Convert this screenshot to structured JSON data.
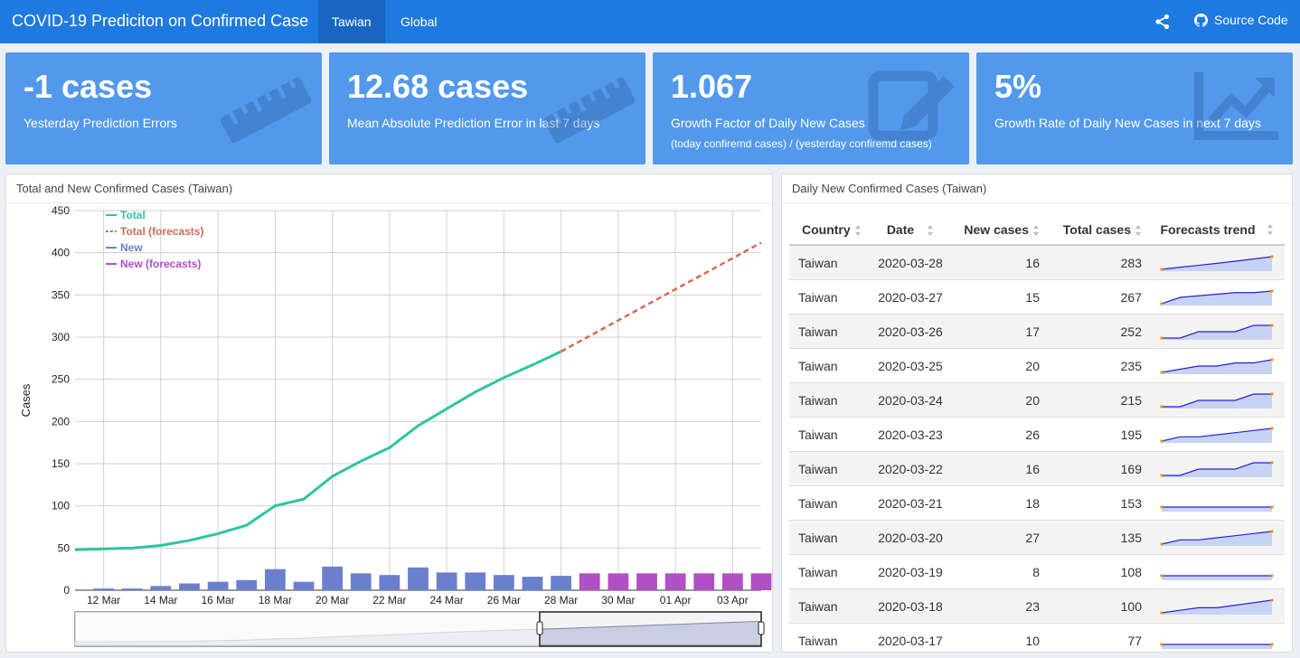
{
  "navbar": {
    "title": "COVID-19 Prediciton on Confirmed Case",
    "tabs": [
      {
        "label": "Tawian",
        "active": true
      },
      {
        "label": "Global",
        "active": false
      }
    ],
    "share_icon": "share-icon",
    "source_label": "Source Code",
    "source_icon": "github-icon",
    "bg_color": "#1f7ae0"
  },
  "value_boxes": [
    {
      "value": "-1 cases",
      "subtitle": "Yesterday Prediction Errors",
      "note": "",
      "icon": "ruler-icon"
    },
    {
      "value": "12.68 cases",
      "subtitle": "Mean Absolute Prediction Error in last 7 days",
      "note": "",
      "icon": "ruler-icon"
    },
    {
      "value": "1.067",
      "subtitle": "Growth Factor of Daily New Cases",
      "note": "(today confiremd cases) / (yesterday confiremd cases)",
      "icon": "edit-icon"
    },
    {
      "value": "5%",
      "subtitle": "Growth Rate of Daily New Cases in next 7 days",
      "note": "",
      "icon": "chart-line-icon"
    }
  ],
  "chart_panel": {
    "title": "Total and New Confirmed Cases (Taiwan)"
  },
  "table_panel": {
    "title": "Daily New Confirmed Cases (Taiwan)"
  },
  "chart_data": {
    "type": "line",
    "ylabel": "Cases",
    "ylim": [
      0,
      450
    ],
    "yticks": [
      0,
      50,
      100,
      150,
      200,
      250,
      300,
      350,
      400,
      450
    ],
    "xtick_labels": [
      "12 Mar",
      "14 Mar",
      "16 Mar",
      "18 Mar",
      "20 Mar",
      "22 Mar",
      "24 Mar",
      "26 Mar",
      "28 Mar",
      "30 Mar",
      "01 Apr",
      "03 Apr"
    ],
    "legend_position": "top-left",
    "grid": true,
    "series": [
      {
        "name": "Total",
        "kind": "line",
        "color": "#2ec4a1",
        "x": [
          "2020-03-11",
          "2020-03-12",
          "2020-03-13",
          "2020-03-14",
          "2020-03-15",
          "2020-03-16",
          "2020-03-17",
          "2020-03-18",
          "2020-03-19",
          "2020-03-20",
          "2020-03-21",
          "2020-03-22",
          "2020-03-23",
          "2020-03-24",
          "2020-03-25",
          "2020-03-26",
          "2020-03-27",
          "2020-03-28"
        ],
        "values": [
          48,
          49,
          50,
          53,
          59,
          67,
          77,
          100,
          108,
          135,
          153,
          169,
          195,
          215,
          235,
          252,
          267,
          283
        ]
      },
      {
        "name": "Total (forecasts)",
        "kind": "dashed-line",
        "color": "#d26b55",
        "x": [
          "2020-03-28",
          "2020-04-04"
        ],
        "values": [
          283,
          412
        ]
      },
      {
        "name": "New",
        "kind": "bar",
        "color": "#6b80cc",
        "x": [
          "2020-03-12",
          "2020-03-13",
          "2020-03-14",
          "2020-03-15",
          "2020-03-16",
          "2020-03-17",
          "2020-03-18",
          "2020-03-19",
          "2020-03-20",
          "2020-03-21",
          "2020-03-22",
          "2020-03-23",
          "2020-03-24",
          "2020-03-25",
          "2020-03-26",
          "2020-03-27",
          "2020-03-28"
        ],
        "values": [
          2,
          2,
          5,
          8,
          10,
          12,
          25,
          10,
          28,
          20,
          18,
          27,
          21,
          21,
          18,
          16,
          17
        ]
      },
      {
        "name": "New (forecasts)",
        "kind": "bar",
        "color": "#b14fc5",
        "x": [
          "2020-03-29",
          "2020-03-30",
          "2020-03-31",
          "2020-04-01",
          "2020-04-02",
          "2020-04-03",
          "2020-04-04"
        ],
        "values": [
          20,
          20,
          20,
          20,
          20,
          20,
          20
        ]
      }
    ]
  },
  "table": {
    "columns": [
      "Country",
      "Date",
      "New cases",
      "Total cases",
      "Forecasts trend"
    ],
    "rows": [
      {
        "country": "Taiwan",
        "date": "2020-03-28",
        "new": "16",
        "total": "283",
        "trend": [
          235,
          252,
          267,
          283,
          300,
          318,
          336
        ]
      },
      {
        "country": "Taiwan",
        "date": "2020-03-27",
        "new": "15",
        "total": "267",
        "trend": [
          10,
          14,
          15,
          16,
          17,
          17,
          18
        ]
      },
      {
        "country": "Taiwan",
        "date": "2020-03-26",
        "new": "17",
        "total": "252",
        "trend": [
          16,
          16,
          17,
          17,
          17,
          18,
          18
        ]
      },
      {
        "country": "Taiwan",
        "date": "2020-03-25",
        "new": "20",
        "total": "235",
        "trend": [
          15,
          16,
          17,
          17,
          18,
          18,
          19
        ]
      },
      {
        "country": "Taiwan",
        "date": "2020-03-24",
        "new": "20",
        "total": "215",
        "trend": [
          16,
          16,
          17,
          17,
          17,
          18,
          18
        ]
      },
      {
        "country": "Taiwan",
        "date": "2020-03-23",
        "new": "26",
        "total": "195",
        "trend": [
          13,
          15,
          15,
          16,
          17,
          18,
          19
        ]
      },
      {
        "country": "Taiwan",
        "date": "2020-03-22",
        "new": "16",
        "total": "169",
        "trend": [
          15,
          15,
          16,
          16,
          16,
          17,
          17
        ]
      },
      {
        "country": "Taiwan",
        "date": "2020-03-21",
        "new": "18",
        "total": "153",
        "trend": [
          17,
          17,
          17,
          17,
          17,
          17,
          17
        ]
      },
      {
        "country": "Taiwan",
        "date": "2020-03-20",
        "new": "27",
        "total": "135",
        "trend": [
          13,
          15,
          15,
          16,
          17,
          18,
          19
        ]
      },
      {
        "country": "Taiwan",
        "date": "2020-03-19",
        "new": "8",
        "total": "108",
        "trend": [
          17,
          17,
          17,
          17,
          17,
          17,
          17
        ]
      },
      {
        "country": "Taiwan",
        "date": "2020-03-18",
        "new": "23",
        "total": "100",
        "trend": [
          14,
          15,
          16,
          16,
          17,
          18,
          19
        ]
      },
      {
        "country": "Taiwan",
        "date": "2020-03-17",
        "new": "10",
        "total": "77",
        "trend": [
          17,
          17,
          17,
          17,
          17,
          17,
          17
        ]
      }
    ]
  }
}
